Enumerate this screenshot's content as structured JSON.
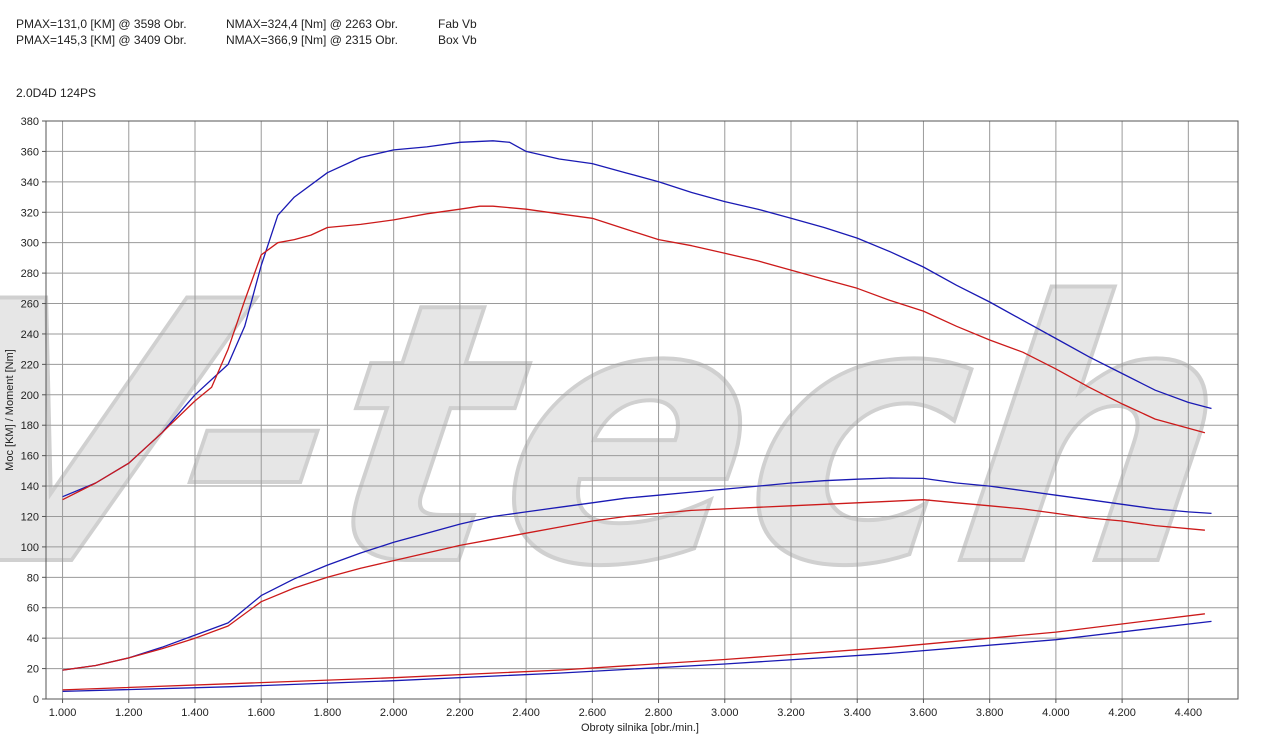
{
  "header": {
    "rows": [
      {
        "pmax": "PMAX=131,0 [KM] @ 3598 Obr.",
        "nmax": "NMAX=324,4 [Nm] @ 2263 Obr.",
        "series": "Fab Vb"
      },
      {
        "pmax": "PMAX=145,3 [KM] @ 3409 Obr.",
        "nmax": "NMAX=366,9 [Nm] @ 2315 Obr.",
        "series": "Box Vb"
      }
    ]
  },
  "engine": "2.0D4D 124PS",
  "watermark": "V-tech",
  "colors": {
    "fab": "#cc1a1a",
    "box": "#1a1ab4",
    "grid": "#9a9a9a",
    "frame": "#555555"
  },
  "chart_data": {
    "type": "line",
    "xlabel": "Obroty silnika [obr./min.]",
    "ylabel": "Moc [KM] / Moment [Nm]",
    "xlim": [
      0.95,
      4.55
    ],
    "ylim": [
      0,
      380
    ],
    "xticks": [
      1.0,
      1.2,
      1.4,
      1.6,
      1.8,
      2.0,
      2.2,
      2.4,
      2.6,
      2.8,
      3.0,
      3.2,
      3.4,
      3.6,
      3.8,
      4.0,
      4.2,
      4.4
    ],
    "xtick_labels": [
      "1.000",
      "1.200",
      "1.400",
      "1.600",
      "1.800",
      "2.000",
      "2.200",
      "2.400",
      "2.600",
      "2.800",
      "3.000",
      "3.200",
      "3.400",
      "3.600",
      "3.800",
      "4.000",
      "4.200",
      "4.400"
    ],
    "yticks": [
      0,
      20,
      40,
      60,
      80,
      100,
      120,
      140,
      160,
      180,
      200,
      220,
      240,
      260,
      280,
      300,
      320,
      340,
      360,
      380
    ],
    "ytick_labels": [
      "0",
      "20",
      "40",
      "60",
      "80",
      "100",
      "120",
      "140",
      "160",
      "180",
      "200",
      "220",
      "240",
      "260",
      "280",
      "300",
      "320",
      "340",
      "360",
      "380"
    ],
    "series": [
      {
        "key": "box_torque",
        "color": "#1a1ab4",
        "x": [
          1.0,
          1.1,
          1.2,
          1.3,
          1.4,
          1.5,
          1.55,
          1.6,
          1.65,
          1.7,
          1.8,
          1.9,
          2.0,
          2.1,
          2.2,
          2.3,
          2.35,
          2.4,
          2.5,
          2.6,
          2.7,
          2.8,
          2.9,
          3.0,
          3.1,
          3.2,
          3.3,
          3.4,
          3.5,
          3.6,
          3.7,
          3.8,
          3.9,
          4.0,
          4.1,
          4.2,
          4.3,
          4.4,
          4.47
        ],
        "y": [
          133,
          142,
          155,
          175,
          200,
          220,
          245,
          285,
          318,
          330,
          346,
          356,
          361,
          363,
          366,
          367,
          366,
          360,
          355,
          352,
          346,
          340,
          333,
          327,
          322,
          316,
          310,
          303,
          294,
          284,
          272,
          261,
          249,
          237,
          225,
          214,
          203,
          195,
          191
        ]
      },
      {
        "key": "fab_torque",
        "color": "#cc1a1a",
        "x": [
          1.0,
          1.1,
          1.2,
          1.3,
          1.4,
          1.45,
          1.5,
          1.55,
          1.6,
          1.65,
          1.7,
          1.75,
          1.8,
          1.9,
          2.0,
          2.1,
          2.2,
          2.26,
          2.3,
          2.4,
          2.5,
          2.6,
          2.7,
          2.8,
          2.9,
          3.0,
          3.1,
          3.2,
          3.3,
          3.4,
          3.5,
          3.6,
          3.7,
          3.8,
          3.9,
          4.0,
          4.1,
          4.2,
          4.3,
          4.45
        ],
        "y": [
          131,
          142,
          155,
          175,
          196,
          205,
          230,
          262,
          292,
          300,
          302,
          305,
          310,
          312,
          315,
          319,
          322,
          324,
          324,
          322,
          319,
          316,
          309,
          302,
          298,
          293,
          288,
          282,
          276,
          270,
          262,
          255,
          245,
          236,
          228,
          217,
          205,
          194,
          184,
          175
        ]
      },
      {
        "key": "box_power",
        "color": "#1a1ab4",
        "x": [
          1.0,
          1.1,
          1.2,
          1.3,
          1.4,
          1.5,
          1.6,
          1.7,
          1.8,
          1.9,
          2.0,
          2.1,
          2.2,
          2.3,
          2.4,
          2.5,
          2.6,
          2.7,
          2.8,
          2.9,
          3.0,
          3.1,
          3.2,
          3.3,
          3.4,
          3.5,
          3.6,
          3.7,
          3.8,
          3.9,
          4.0,
          4.1,
          4.2,
          4.3,
          4.4,
          4.47
        ],
        "y": [
          19,
          22,
          27,
          34,
          42,
          50,
          68,
          79,
          88,
          96,
          103,
          109,
          115,
          120,
          123,
          126,
          129,
          132,
          134,
          136,
          138,
          140,
          142,
          143.5,
          144.5,
          145.3,
          145,
          142,
          140,
          137,
          134,
          131,
          128,
          125,
          123,
          122
        ]
      },
      {
        "key": "fab_power",
        "color": "#cc1a1a",
        "x": [
          1.0,
          1.1,
          1.2,
          1.3,
          1.4,
          1.5,
          1.6,
          1.7,
          1.8,
          1.9,
          2.0,
          2.1,
          2.2,
          2.3,
          2.4,
          2.5,
          2.6,
          2.7,
          2.8,
          2.9,
          3.0,
          3.1,
          3.2,
          3.3,
          3.4,
          3.5,
          3.6,
          3.7,
          3.8,
          3.9,
          4.0,
          4.1,
          4.2,
          4.3,
          4.45
        ],
        "y": [
          19,
          22,
          27,
          33,
          40,
          48,
          64,
          73,
          80,
          86,
          91,
          96,
          101,
          105,
          109,
          113,
          117,
          120,
          122,
          124,
          125,
          126,
          127,
          128,
          129,
          130,
          131,
          129,
          127,
          125,
          122,
          119,
          117,
          114,
          111
        ]
      },
      {
        "key": "fab_low",
        "color": "#cc1a1a",
        "x": [
          1.0,
          1.5,
          2.0,
          2.5,
          3.0,
          3.5,
          4.0,
          4.45
        ],
        "y": [
          6,
          10,
          14,
          19,
          26,
          34,
          44,
          56
        ]
      },
      {
        "key": "box_low",
        "color": "#1a1ab4",
        "x": [
          1.0,
          1.5,
          2.0,
          2.5,
          3.0,
          3.5,
          4.0,
          4.47
        ],
        "y": [
          5,
          8,
          12,
          17,
          23,
          30,
          39,
          51
        ]
      }
    ]
  }
}
